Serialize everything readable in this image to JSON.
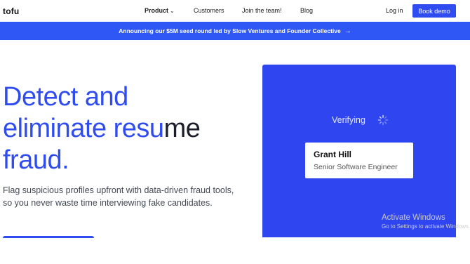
{
  "nav": {
    "logo": "tofu",
    "product": "Product",
    "customers": "Customers",
    "join": "Join the team!",
    "blog": "Blog",
    "login": "Log in",
    "book_demo": "Book demo"
  },
  "announcement": {
    "text": "Announcing our $5M seed round led by Slow Ventures and Founder Collective",
    "arrow": "→"
  },
  "hero": {
    "line1": "Detect and",
    "line2_blue": "eliminate resu",
    "line2_dark": "me",
    "line3": "fraud.",
    "subtext": "Flag suspicious profiles upfront with data-driven fraud tools, so you never waste time interviewing fake candidates."
  },
  "demo": {
    "status": "Verifying",
    "card_name": "Grant Hill",
    "card_role": "Senior Software Engineer"
  },
  "watermark": {
    "title": "Activate Windows",
    "subtitle": "Go to Settings to activate Windows."
  },
  "colors": {
    "brand_blue": "#2f4cf0",
    "announce_blue": "#2f57f6",
    "panel_blue": "#2f45ef"
  }
}
